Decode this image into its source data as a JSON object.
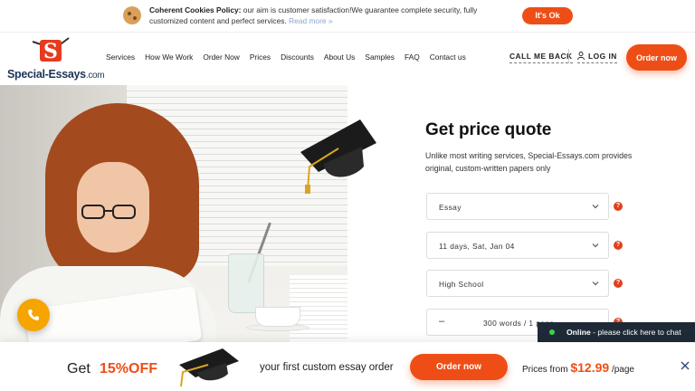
{
  "cookie": {
    "title": "Coherent Cookies Policy:",
    "text": " our aim is customer satisfaction!We guarantee complete security, fully customized content and perfect services. ",
    "read_more": "Read more »",
    "ok_label": "It's Ok"
  },
  "header": {
    "logo_name": "Special-Essays",
    "logo_suffix": ".com",
    "nav": [
      "Services",
      "How We Work",
      "Order Now",
      "Prices",
      "Discounts",
      "About Us",
      "Samples",
      "FAQ",
      "Contact us"
    ],
    "call_me_back": "CALL ME BACK",
    "log_in": "LOG IN",
    "order_now": "Order now"
  },
  "quote": {
    "title": "Get price quote",
    "description": "Unlike most writing services, Special-Essays.com provides original, custom-written papers only",
    "paper_type": "Essay",
    "deadline": "11 days, Sat, Jan 04",
    "level": "High School",
    "pages": "300 words / 1 page",
    "minus_label": "–",
    "help_icon_label": "?"
  },
  "chat": {
    "status": "Online",
    "text": " - please click here to chat"
  },
  "promo": {
    "get": "Get",
    "discount": "15%OFF",
    "text": "your first custom essay order",
    "button": "Order now",
    "price_prefix": "Prices from ",
    "price": "$12.99",
    "price_suffix": " /page"
  },
  "colors": {
    "accent": "#ee4e16",
    "phone": "#f5a400",
    "chat_bg": "#1f2a38",
    "online": "#3fd34a"
  }
}
